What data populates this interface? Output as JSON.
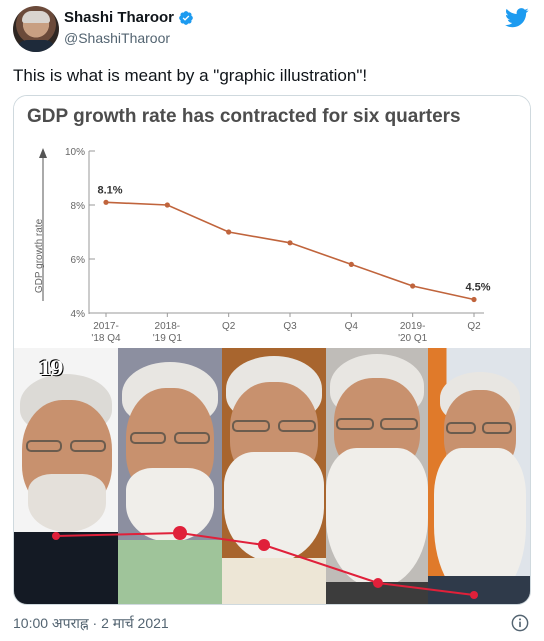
{
  "author": {
    "display_name": "Shashi Tharoor",
    "handle": "@ShashiTharoor",
    "verified": true,
    "avatar_icon": "user-avatar"
  },
  "tweet": {
    "text": "This is what is meant by a \"graphic illustration\"!",
    "timestamp": "10:00 अपराह्न · 2 मार्च 2021"
  },
  "icons": {
    "brand": "twitter-bird-icon",
    "verified": "verified-badge-icon",
    "info": "info-icon"
  },
  "colors": {
    "twitter_blue": "#1d9bf0",
    "line_color": "#c0643c",
    "decline_arrow": "#e0203a"
  },
  "chart_data": {
    "type": "line",
    "title": "GDP growth rate has contracted for six quarters",
    "ylabel": "GDP growth rate",
    "xlabel": "",
    "categories": [
      "2017-'18 Q4",
      "2018-'19 Q1",
      "Q2",
      "Q3",
      "Q4",
      "2019-'20 Q1",
      "Q2"
    ],
    "category_lines": [
      [
        "2017-",
        "'18 Q4"
      ],
      [
        "2018-",
        "'19 Q1"
      ],
      [
        "Q2"
      ],
      [
        "Q3"
      ],
      [
        "Q4"
      ],
      [
        "2019-",
        "'20 Q1"
      ],
      [
        "Q2"
      ]
    ],
    "values": [
      8.1,
      8.0,
      7.0,
      6.6,
      5.8,
      5.0,
      4.5
    ],
    "value_labels": [
      "8.1%",
      "",
      "",
      "",
      "",
      "",
      "4.5%"
    ],
    "yticks": [
      "4%",
      "6%",
      "8%",
      "10%"
    ],
    "ytick_values": [
      4,
      6,
      8,
      10
    ],
    "ylim": [
      4,
      10
    ],
    "grid": false,
    "legend": "none"
  }
}
